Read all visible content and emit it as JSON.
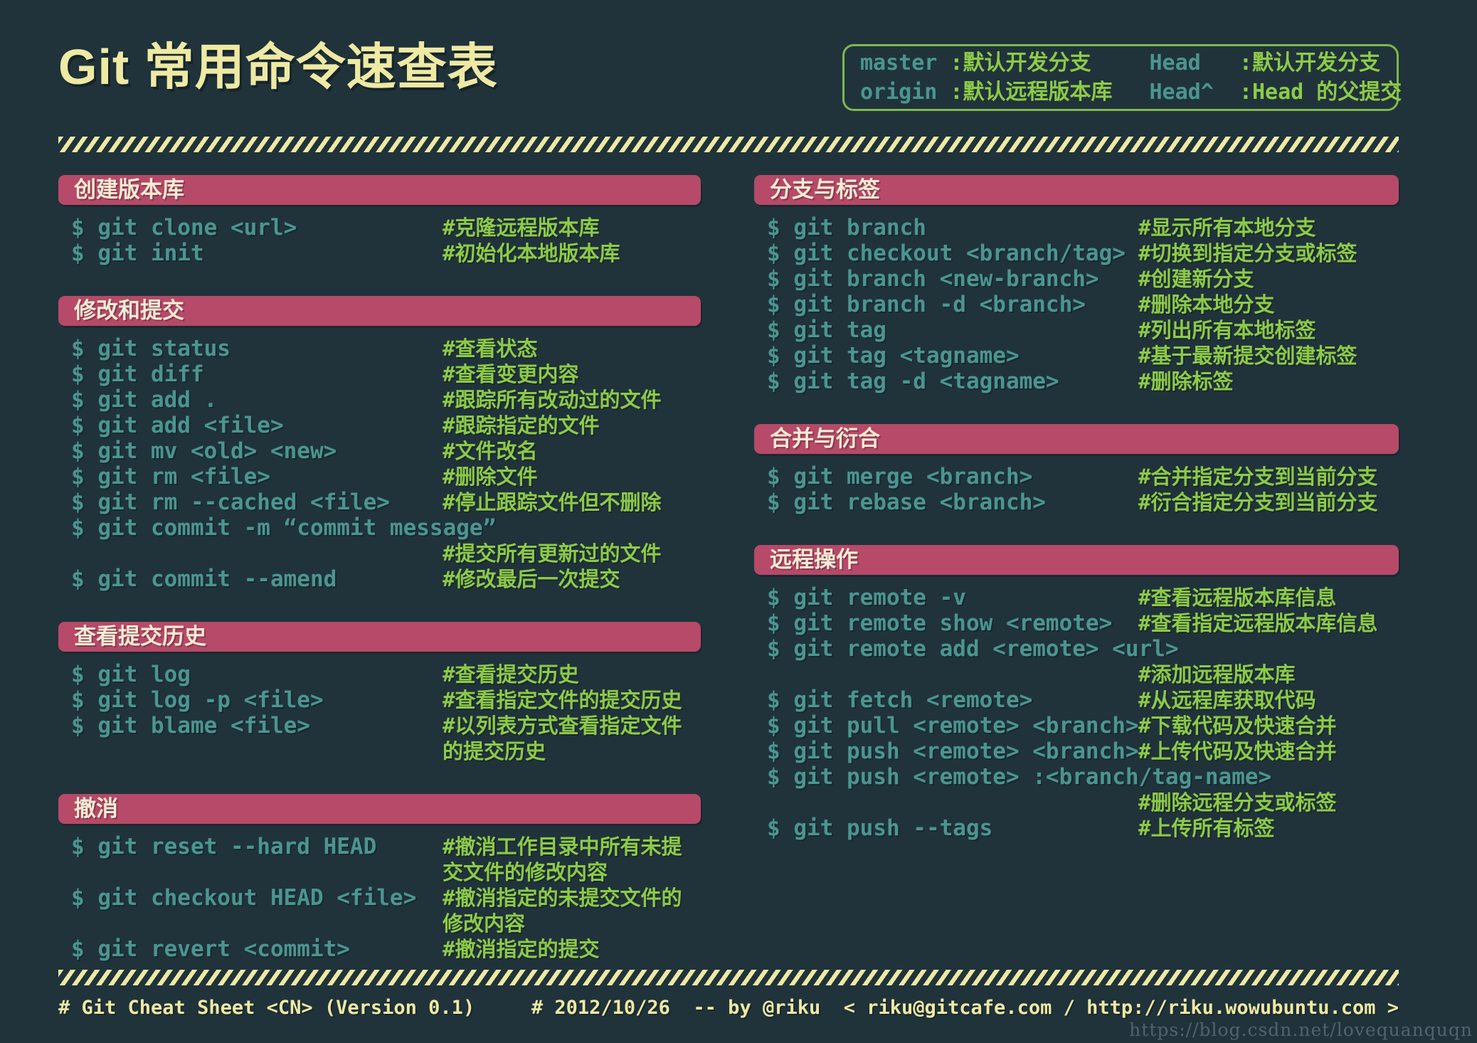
{
  "title": "Git 常用命令速查表",
  "legend": {
    "items": [
      {
        "term": "master",
        "desc": ":默认开发分支"
      },
      {
        "term": "origin",
        "desc": ":默认远程版本库"
      },
      {
        "term": "Head",
        "desc": ":默认开发分支"
      },
      {
        "term": "Head^",
        "desc": ":Head 的父提交"
      }
    ]
  },
  "columns": {
    "left": {
      "sections": [
        {
          "title": "创建版本库",
          "rows": [
            {
              "cmd": "$ git clone <url>",
              "comment": "#克隆远程版本库"
            },
            {
              "cmd": "$ git init",
              "comment": "#初始化本地版本库"
            }
          ]
        },
        {
          "title": "修改和提交",
          "rows": [
            {
              "cmd": "$ git status",
              "comment": "#查看状态"
            },
            {
              "cmd": "$ git diff",
              "comment": "#查看变更内容"
            },
            {
              "cmd": "$ git add .",
              "comment": "#跟踪所有改动过的文件"
            },
            {
              "cmd": "$ git add <file>",
              "comment": "#跟踪指定的文件"
            },
            {
              "cmd": "$ git mv <old> <new>",
              "comment": "#文件改名"
            },
            {
              "cmd": "$ git rm <file>",
              "comment": "#删除文件"
            },
            {
              "cmd": "$ git rm --cached <file>",
              "comment": "#停止跟踪文件但不删除"
            },
            {
              "cmd": "$ git commit -m “commit message”",
              "comment": ""
            },
            {
              "cmd": "",
              "comment": "#提交所有更新过的文件"
            },
            {
              "cmd": "$ git commit --amend",
              "comment": "#修改最后一次提交"
            }
          ]
        },
        {
          "title": "查看提交历史",
          "rows": [
            {
              "cmd": "$ git log",
              "comment": "#查看提交历史"
            },
            {
              "cmd": "$ git log -p <file>",
              "comment": "#查看指定文件的提交历史"
            },
            {
              "cmd": "$ git blame <file>",
              "comment": "#以列表方式查看指定文件的提交历史"
            }
          ]
        },
        {
          "title": "撤消",
          "rows": [
            {
              "cmd": "$ git reset --hard HEAD",
              "comment": "#撤消工作目录中所有未提交文件的修改内容"
            },
            {
              "cmd": "$ git checkout HEAD <file>",
              "comment": "#撤消指定的未提交文件的修改内容"
            },
            {
              "cmd": "$ git revert <commit>",
              "comment": "#撤消指定的提交"
            }
          ]
        }
      ]
    },
    "right": {
      "sections": [
        {
          "title": "分支与标签",
          "rows": [
            {
              "cmd": "$ git branch",
              "comment": "#显示所有本地分支"
            },
            {
              "cmd": "$ git checkout <branch/tag>",
              "comment": "#切换到指定分支或标签"
            },
            {
              "cmd": "$ git branch <new-branch>",
              "comment": "#创建新分支"
            },
            {
              "cmd": "$ git branch -d <branch>",
              "comment": "#删除本地分支"
            },
            {
              "cmd": "$ git tag",
              "comment": "#列出所有本地标签"
            },
            {
              "cmd": "$ git tag <tagname>",
              "comment": "#基于最新提交创建标签"
            },
            {
              "cmd": "$ git tag -d <tagname>",
              "comment": "#删除标签"
            }
          ]
        },
        {
          "title": "合并与衍合",
          "rows": [
            {
              "cmd": "$ git merge <branch>",
              "comment": "#合并指定分支到当前分支"
            },
            {
              "cmd": "$ git rebase <branch>",
              "comment": "#衍合指定分支到当前分支"
            }
          ]
        },
        {
          "title": "远程操作",
          "rows": [
            {
              "cmd": "$ git remote -v",
              "comment": "#查看远程版本库信息"
            },
            {
              "cmd": "$ git remote show <remote>",
              "comment": "#查看指定远程版本库信息"
            },
            {
              "cmd": "$ git remote add <remote> <url>",
              "comment": ""
            },
            {
              "cmd": "",
              "comment": "#添加远程版本库"
            },
            {
              "cmd": "$ git fetch <remote>",
              "comment": "#从远程库获取代码"
            },
            {
              "cmd": "$ git pull <remote> <branch>",
              "comment": "#下载代码及快速合并"
            },
            {
              "cmd": "$ git push <remote> <branch>",
              "comment": "#上传代码及快速合并"
            },
            {
              "cmd": "$ git push <remote> :<branch/tag-name>",
              "comment": ""
            },
            {
              "cmd": "",
              "comment": "#删除远程分支或标签"
            },
            {
              "cmd": "$ git push --tags",
              "comment": "#上传所有标签"
            }
          ]
        }
      ]
    }
  },
  "footer": {
    "left": "# Git Cheat Sheet <CN> (Version 0.1)",
    "right": "# 2012/10/26  -- by @riku  < riku@gitcafe.com / http://riku.wowubuntu.com >"
  },
  "watermark": "https://blog.csdn.net/lovequanquqn",
  "colors": {
    "background": "#20333b",
    "cream": "#eee9a3",
    "section_header_bg": "#b64a68",
    "section_header_text": "#f6ebd5",
    "command_teal": "#4b9590",
    "comment_green": "#8dca47",
    "legend_border": "#7db94d",
    "watermark_gray": "#4e6470"
  }
}
